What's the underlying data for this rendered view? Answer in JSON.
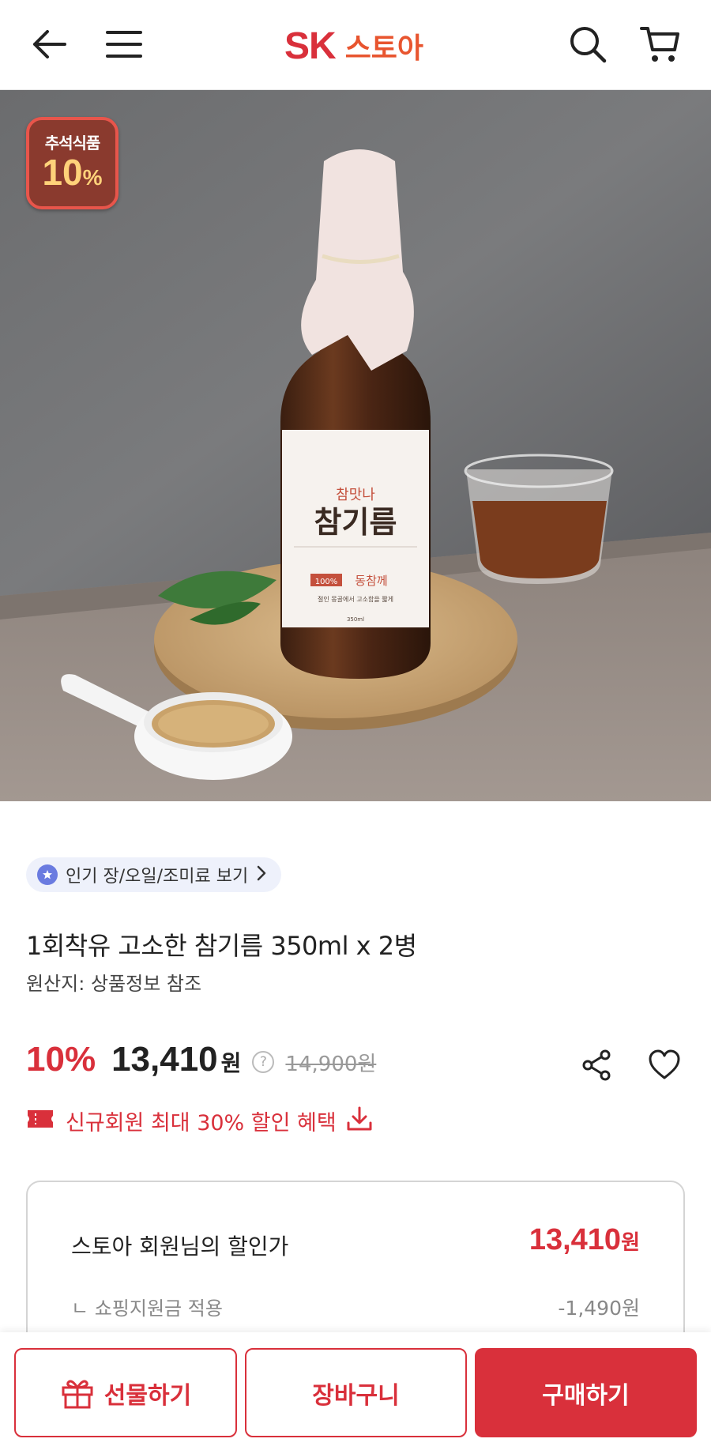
{
  "header": {
    "logo_sk": "SK",
    "logo_store": "스토아",
    "icons": [
      "back-arrow-icon",
      "menu-icon",
      "search-icon",
      "cart-icon"
    ],
    "brand_color": "#d9303b"
  },
  "hero": {
    "badge_top": "추석식품",
    "badge_number": "10",
    "badge_percent": "%",
    "label_small": "참맛나",
    "label_big": "참기름",
    "label_tag": "100%",
    "label_tag_text": "동참께",
    "label_desc": "절인 몽골에서 고소함을 짧게",
    "label_vol": "350ml"
  },
  "category_chip": {
    "label": "인기 장/오일/조미료 보기"
  },
  "product": {
    "title": "1회착유 고소한 참기름 350ml x 2병",
    "origin": "원산지: 상품정보 참조"
  },
  "price": {
    "discount": "10%",
    "sale_price": "13,410",
    "won": "원",
    "help": "?",
    "original_price": "14,900원"
  },
  "coupon": {
    "label": "신규회원 최대 30% 할인 혜택"
  },
  "member_box": {
    "label": "스토아 회원님의 할인가",
    "price": "13,410",
    "won": "원",
    "sub_label": "ㄴ 쇼핑지원금 적용",
    "sub_value": "-1,490원"
  },
  "bottom_bar": {
    "gift": "선물하기",
    "cart": "장바구니",
    "buy": "구매하기"
  }
}
